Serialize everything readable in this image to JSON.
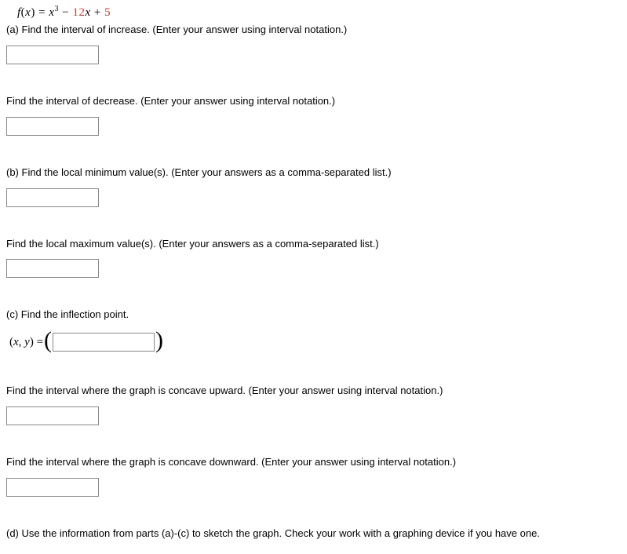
{
  "equation": {
    "prefix_italic": "f",
    "func_open": "(",
    "var1": "x",
    "func_close": ") = ",
    "var2": "x",
    "exp": "3",
    "middle": " − ",
    "red_part": "12",
    "var3": "x",
    "plus": " + ",
    "red_tail": "5"
  },
  "parts": {
    "a": {
      "increase": "(a) Find the interval of increase. (Enter your answer using interval notation.)",
      "decrease": "Find the interval of decrease. (Enter your answer using interval notation.)"
    },
    "b": {
      "localmin": "(b) Find the local minimum value(s). (Enter your answers as a comma-separated list.)",
      "localmax": "Find the local maximum value(s). (Enter your answers as a comma-separated list.)"
    },
    "c": {
      "inflection": "(c) Find the inflection point.",
      "xy_prefix_open": "(",
      "xy_vars": "x, y",
      "xy_prefix_close": ")  =  ",
      "concave_up": "Find the interval where the graph is concave upward. (Enter your answer using interval notation.)",
      "concave_down": "Find the interval where the graph is concave downward. (Enter your answer using interval notation.)"
    },
    "d": {
      "sketch": "(d) Use the information from parts (a)-(c) to sketch the graph. Check your work with a graphing device if you have one."
    }
  }
}
